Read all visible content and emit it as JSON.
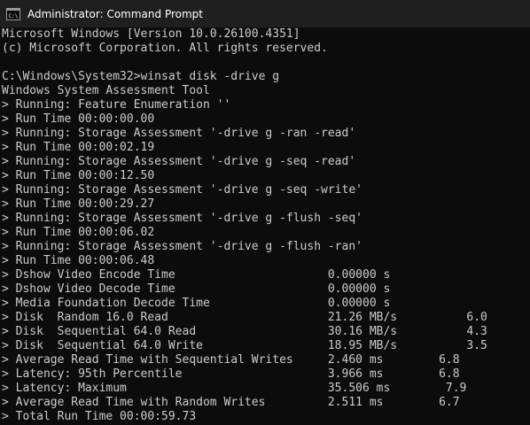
{
  "window": {
    "title": "Administrator: Command Prompt",
    "icon": "cmd-icon",
    "colors": {
      "titlebar": "#1f1f1f",
      "background": "#0c0c0c",
      "text": "#cccccc"
    }
  },
  "console": {
    "lines": [
      "Microsoft Windows [Version 10.0.26100.4351]",
      "(c) Microsoft Corporation. All rights reserved.",
      "",
      "C:\\Windows\\System32>winsat disk -drive g",
      "Windows System Assessment Tool",
      "> Running: Feature Enumeration ''",
      "> Run Time 00:00:00.00",
      "> Running: Storage Assessment '-drive g -ran -read'",
      "> Run Time 00:00:02.19",
      "> Running: Storage Assessment '-drive g -seq -read'",
      "> Run Time 00:00:12.50",
      "> Running: Storage Assessment '-drive g -seq -write'",
      "> Run Time 00:00:29.27",
      "> Running: Storage Assessment '-drive g -flush -seq'",
      "> Run Time 00:00:06.02",
      "> Running: Storage Assessment '-drive g -flush -ran'",
      "> Run Time 00:00:06.48",
      "> Dshow Video Encode Time                      0.00000 s",
      "> Dshow Video Decode Time                      0.00000 s",
      "> Media Foundation Decode Time                 0.00000 s",
      "> Disk  Random 16.0 Read                       21.26 MB/s          6.0",
      "> Disk  Sequential 64.0 Read                   30.16 MB/s          4.3",
      "> Disk  Sequential 64.0 Write                  18.95 MB/s          3.5",
      "> Average Read Time with Sequential Writes     2.460 ms        6.8",
      "> Latency: 95th Percentile                     3.966 ms        6.8",
      "> Latency: Maximum                             35.506 ms        7.9",
      "> Average Read Time with Random Writes         2.511 ms        6.7",
      "> Total Run Time 00:00:59.73"
    ]
  }
}
